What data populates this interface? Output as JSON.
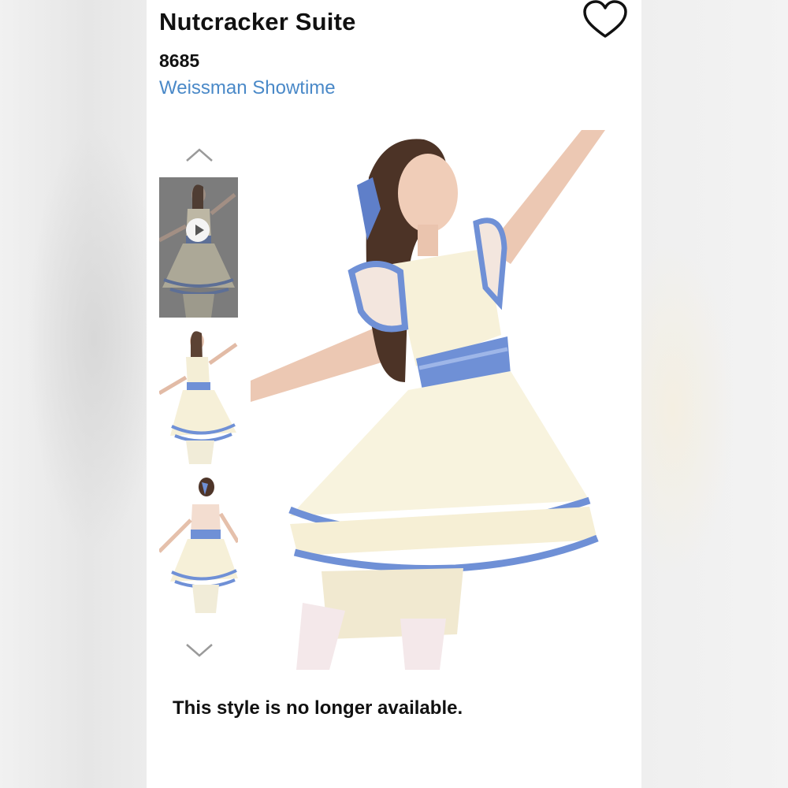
{
  "product": {
    "title": "Nutcracker Suite",
    "sku": "8685",
    "brand": "Weissman Showtime",
    "availability_notice": "This style is no longer available."
  },
  "gallery": {
    "thumbnails": [
      {
        "kind": "video",
        "selected": true
      },
      {
        "kind": "image",
        "view": "front"
      },
      {
        "kind": "image",
        "view": "back"
      }
    ]
  },
  "icons": {
    "favorite": "heart-outline-icon",
    "scroll_up": "chevron-up-icon",
    "scroll_down": "chevron-down-icon",
    "play": "play-icon"
  },
  "colors": {
    "brand_link": "#4a89c8",
    "ribbon_blue": "#6f90d6",
    "dress_cream": "#f7f1d9"
  }
}
